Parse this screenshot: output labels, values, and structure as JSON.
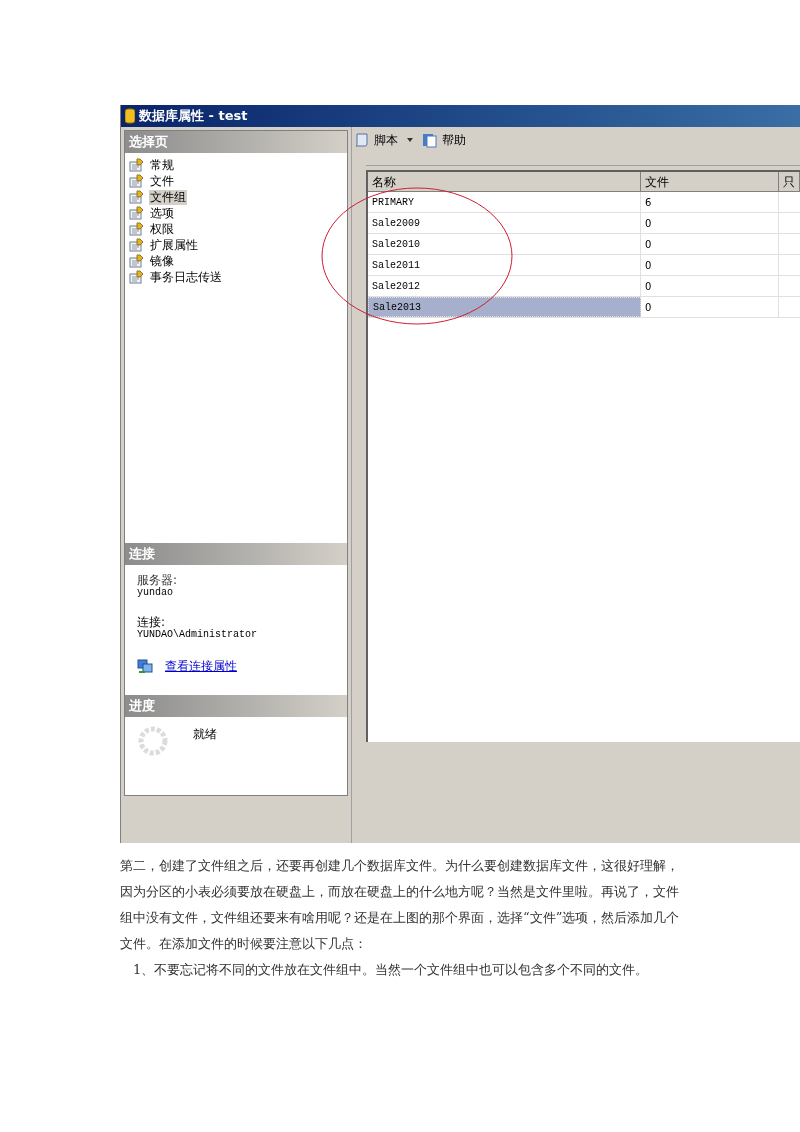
{
  "window": {
    "title": "数据库属性 - test"
  },
  "select_page": {
    "title": "选择页",
    "items": [
      {
        "label": "常规",
        "selected": false
      },
      {
        "label": "文件",
        "selected": false
      },
      {
        "label": "文件组",
        "selected": true
      },
      {
        "label": "选项",
        "selected": false
      },
      {
        "label": "权限",
        "selected": false
      },
      {
        "label": "扩展属性",
        "selected": false
      },
      {
        "label": "镜像",
        "selected": false
      },
      {
        "label": "事务日志传送",
        "selected": false
      }
    ]
  },
  "connection": {
    "title": "连接",
    "server_label": "服务器:",
    "server": "yundao",
    "connection_label": "连接:",
    "connection": "YUNDAO\\Administrator",
    "link": "查看连接属性"
  },
  "progress": {
    "title": "进度",
    "status": "就绪"
  },
  "toolbar": {
    "script": "脚本",
    "help": "帮助"
  },
  "table": {
    "columns": [
      "名称",
      "文件",
      "只"
    ],
    "rows": [
      {
        "cells": [
          "PRIMARY",
          "6"
        ],
        "selected": false
      },
      {
        "cells": [
          "Sale2009",
          "0"
        ],
        "selected": false
      },
      {
        "cells": [
          "Sale2010",
          "0"
        ],
        "selected": false
      },
      {
        "cells": [
          "Sale2011",
          "0"
        ],
        "selected": false
      },
      {
        "cells": [
          "Sale2012",
          "0"
        ],
        "selected": false
      },
      {
        "cells": [
          "Sale2013",
          "0"
        ],
        "selected": true
      }
    ]
  },
  "paragraphs": [
    "第二，创建了文件组之后，还要再创建几个数据库文件。为什么要创建数据库文件，这很好理解，因为分区的小表必须要放在硬盘上，而放在硬盘上的什么地方呢？当然是文件里啦。再说了，文件组中没有文件，文件组还要来有啥用呢？还是在上图的那个界面，选择“文件”选项，然后添加几个文件。在添加文件的时候要注意以下几点：",
    "　1、不要忘记将不同的文件放在文件组中。当然一个文件组中也可以包含多个不同的文件。"
  ]
}
